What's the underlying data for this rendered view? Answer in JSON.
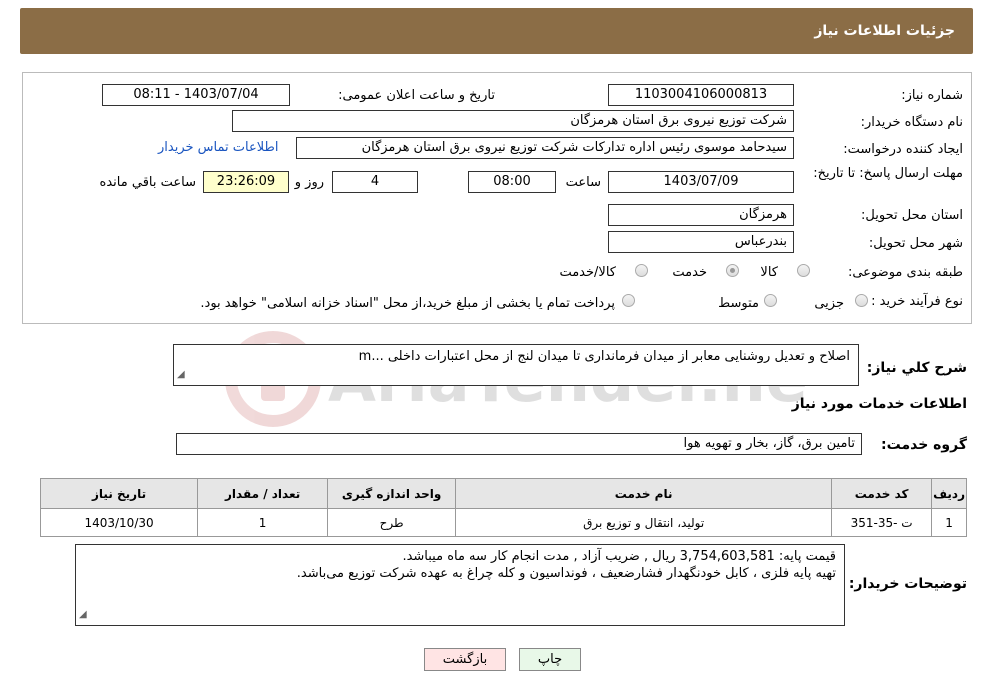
{
  "header": {
    "title": "جزئیات اطلاعات نیاز"
  },
  "form": {
    "need_number_label": "شماره نیاز:",
    "need_number": "1103004106000813",
    "announce_label": "تاریخ و ساعت اعلان عمومی:",
    "announce_value": "1403/07/04 - 08:11",
    "buyer_org_label": "نام دستگاه خریدار:",
    "buyer_org": "شرکت توزیع نیروی برق استان هرمزگان",
    "creator_label": "ایجاد کننده درخواست:",
    "creator": "سیدحامد موسوی رئیس اداره تدارکات شرکت توزیع نیروی برق استان هرمزگان",
    "contact_link": "اطلاعات تماس خریدار",
    "deadline_label": "مهلت ارسال پاسخ: تا تاریخ:",
    "deadline_date": "1403/07/09",
    "hour_label": "ساعت",
    "deadline_time": "08:00",
    "days_value": "4",
    "days_label": "روز و",
    "remaining_time": "23:26:09",
    "remaining_label": "ساعت باقي مانده",
    "province_label": "استان محل تحویل:",
    "province": "هرمزگان",
    "city_label": "شهر محل تحویل:",
    "city": "بندرعباس",
    "category_label": "طبقه بندی موضوعی:",
    "category_options": [
      "کالا",
      "خدمت",
      "کالا/خدمت"
    ],
    "category_selected": "خدمت",
    "process_label": "نوع فرآیند خرید :",
    "process_options": [
      "جزیی",
      "متوسط"
    ],
    "process_note": "پرداخت تمام یا بخشی از مبلغ خرید،از محل \"اسناد خزانه اسلامی\" خواهد بود."
  },
  "watermark": {
    "text": "AriaTender.neT"
  },
  "summary": {
    "label": "شرح کلي نیاز:",
    "text": "اصلاح و تعدیل روشنایی معابر از میدان فرمانداری تا میدان لنج از محل اعتبارات داخلی ...m"
  },
  "services": {
    "section_title": "اطلاعات خدمات مورد نیاز",
    "group_label": "گروه خدمت:",
    "group_value": "تامین برق، گاز، بخار و تهویه هوا",
    "columns": [
      "ردیف",
      "کد خدمت",
      "نام خدمت",
      "واحد اندازه گیری",
      "تعداد / مقدار",
      "تاریخ نیاز"
    ],
    "rows": [
      [
        "1",
        "ت -35-351",
        "تولید، انتقال و توزیع برق",
        "طرح",
        "1",
        "1403/10/30"
      ]
    ]
  },
  "buyer_notes": {
    "label": "توضیحات خریدار:",
    "line1": "قیمت پایه:  3,754,603,581 ریال  , ضریب آزاد , مدت انجام کار سه ماه میباشد.",
    "line2": "تهیه پایه فلزی ، کابل خودنگهدار فشارضعیف ، فونداسیون و کله چراغ  به عهده شرکت توزیع می‌باشد."
  },
  "buttons": {
    "print": "چاپ",
    "back": "بازگشت"
  },
  "colors": {
    "header_bg": "#8B6D46",
    "link": "#1a55c0",
    "back_btn_bg": "#FFE4E4",
    "print_btn_bg": "#E8F8E8"
  }
}
